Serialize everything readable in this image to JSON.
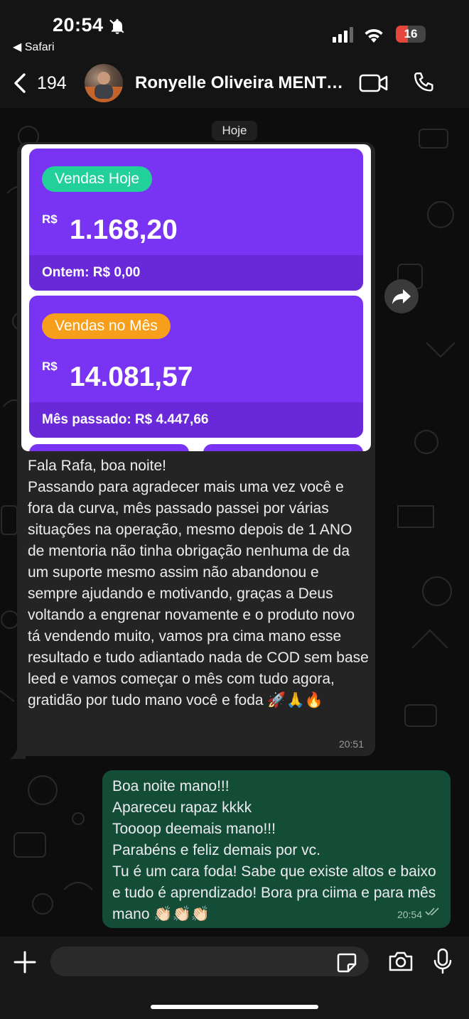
{
  "status_bar": {
    "time": "20:54",
    "back_app": "◀ Safari",
    "battery": "16"
  },
  "header": {
    "back_count": "194",
    "contact_name": "Ronyelle Oliveira MENTORADO",
    "accent_color": "#144d37"
  },
  "chat": {
    "date_chip": "Hoje",
    "incoming": {
      "image": {
        "card1": {
          "badge": "Vendas Hoje",
          "currency": "R$",
          "value": "1.168,20",
          "footer": "Ontem: R$ 0,00"
        },
        "card2": {
          "badge": "Vendas no Mês",
          "currency": "R$",
          "value": "14.081,57",
          "footer": "Mês passado: R$ 4.447,66"
        }
      },
      "text": "Fala Rafa, boa noite!\nPassando para agradecer mais uma vez você e fora da curva, mês passado passei por várias situações na operação, mesmo depois de 1 ANO de mentoria não tinha obrigação nenhuma de da um suporte mesmo assim não abandonou e sempre ajudando e motivando, graças a Deus voltando a engrenar novamente e o produto novo tá vendendo muito, vamos pra cima mano esse resultado e tudo adiantado nada de COD sem base leed e vamos começar o mês com tudo agora, gratidão por tudo mano você e foda 🚀🙏🔥",
      "time": "20:51"
    },
    "outgoing": {
      "text": "Boa noite mano!!!\nApareceu rapaz kkkk\nToooop deemais mano!!!\nParabéns e feliz demais por vc.\nTu é um cara foda! Sabe que existe altos e baixo e tudo é aprendizado! Bora pra ciima e para mês mano 👏🏻👏🏻👏🏻",
      "time": "20:54"
    }
  },
  "input_bar": {
    "placeholder": ""
  }
}
